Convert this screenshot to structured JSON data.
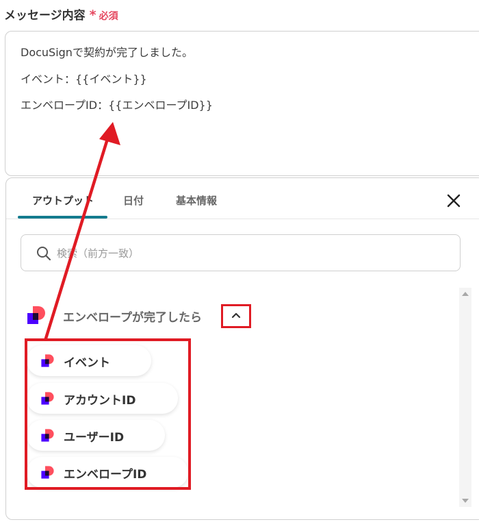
{
  "field": {
    "label": "メッセージ内容",
    "required_mark": "*",
    "required_text": "必須"
  },
  "message": {
    "lines": [
      "DocuSignで契約が完了しました。",
      "イベント：{{イベント}}",
      "エンベロープID：{{エンベロープID}}"
    ]
  },
  "panel": {
    "tabs": [
      {
        "label": "アウトプット",
        "active": true
      },
      {
        "label": "日付",
        "active": false
      },
      {
        "label": "基本情報",
        "active": false
      }
    ],
    "search": {
      "placeholder": "検索（前方一致）",
      "value": ""
    },
    "group": {
      "title": "エンベロープが完了したら",
      "expanded": true,
      "items": [
        {
          "label": "イベント"
        },
        {
          "label": "アカウントID"
        },
        {
          "label": "ユーザーID"
        },
        {
          "label": "エンベロープID"
        }
      ]
    }
  },
  "colors": {
    "accent_teal": "#137b8e",
    "required_red": "#e5475f",
    "annotation_red": "#e01b24",
    "logo_red": "#ff4f5e",
    "logo_purple": "#4c00ff"
  },
  "icons": [
    "search-icon",
    "close-icon",
    "chevron-up-icon",
    "docusign-logo-icon"
  ]
}
